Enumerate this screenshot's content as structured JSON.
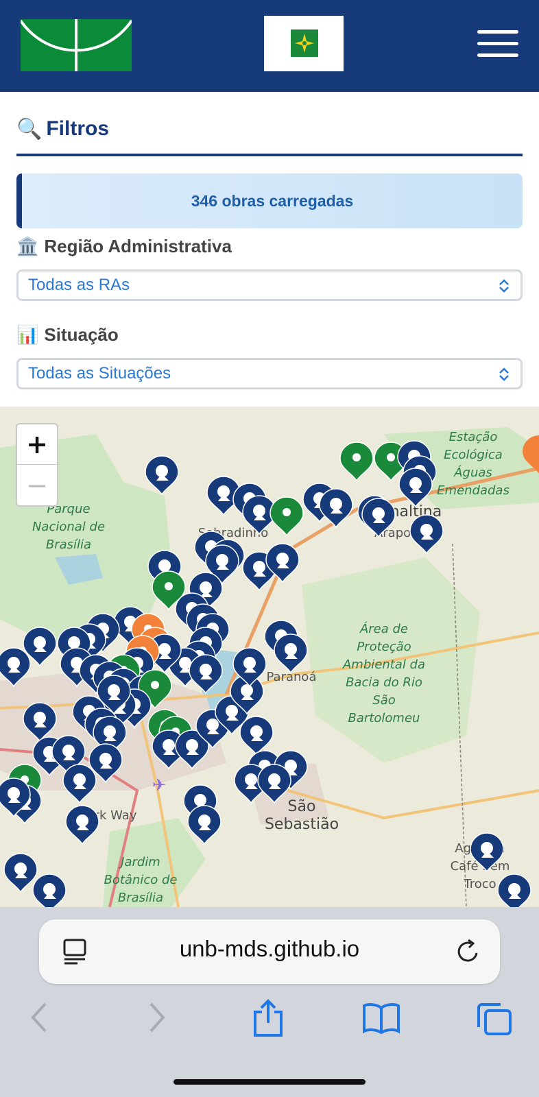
{
  "header": {
    "logo_name": "unb-logo",
    "flag_name": "df-flag",
    "menu_icon": "hamburger-menu-icon",
    "colors": {
      "background": "#173a7a",
      "logo_green": "#0b8a3a"
    }
  },
  "filters": {
    "title": "Filtros",
    "title_icon": "magnifier-icon",
    "count_text": "346 obras carregadas",
    "region": {
      "label": "Região Administrativa",
      "icon": "building-icon",
      "selected": "Todas as RAs"
    },
    "status": {
      "label": "Situação",
      "icon": "bar-chart-icon",
      "selected": "Todas as Situações"
    }
  },
  "map": {
    "zoom_in": "+",
    "zoom_out": "−",
    "place_labels": [
      "Estação Ecológica Águas Emendadas",
      "Parque Nacional de Brasília",
      "Sobradinho II",
      "Planaltina",
      "Arapoanga",
      "Área de Proteção Ambiental da Bacia do Rio São Bartolomeu",
      "Paranoá",
      "São Sebastião",
      "Park Way",
      "Jardim Botânico de Brasília",
      "Agrovila Café Sem Troco"
    ],
    "marker_colors": {
      "blue": "#173a7a",
      "green": "#1a8a3a",
      "orange": "#f2823a"
    }
  },
  "browser": {
    "url": "unb-mds.github.io",
    "reader_icon": "reader-mode-icon",
    "reload_icon": "reload-icon",
    "nav": [
      "back-icon",
      "forward-icon",
      "share-icon",
      "bookmarks-icon",
      "tabs-icon"
    ]
  }
}
